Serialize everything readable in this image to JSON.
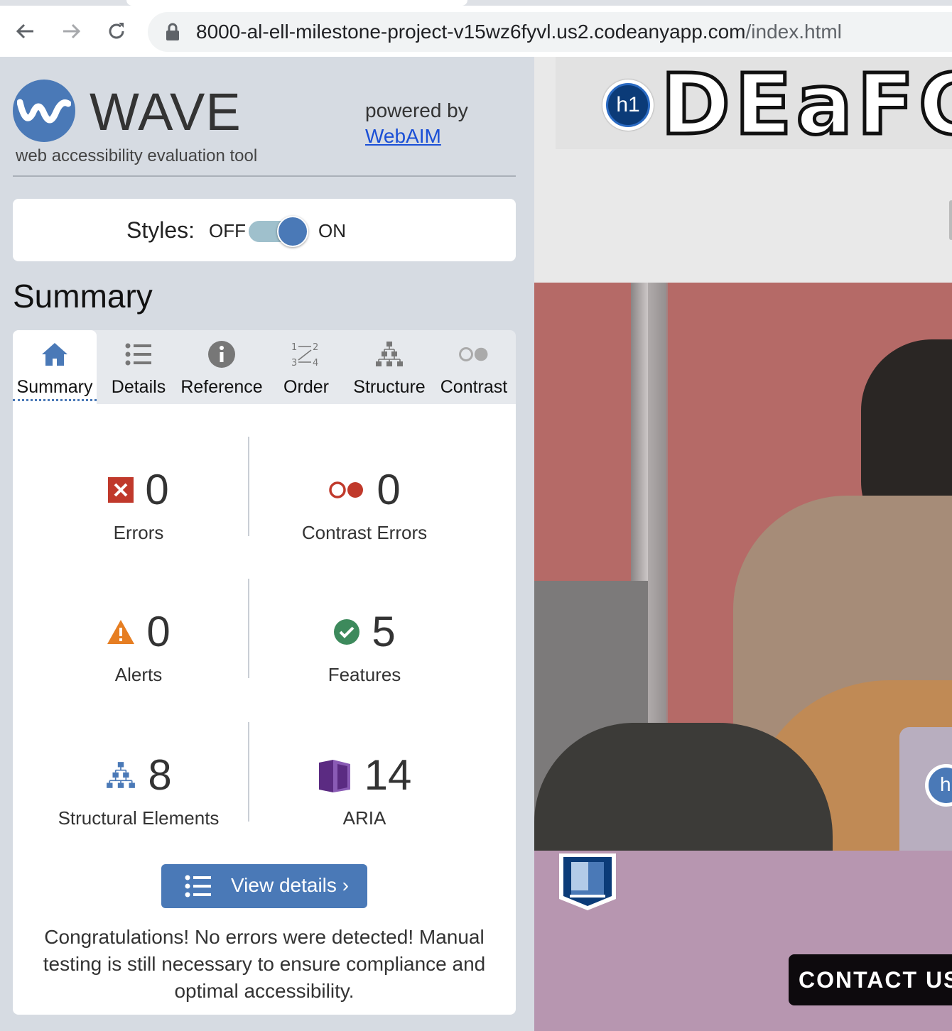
{
  "browser": {
    "url_host": "8000-al-ell-milestone-project-v15wz6fyvl.us2.codeanyapp.com",
    "url_path": "/index.html"
  },
  "wave": {
    "title": "WAVE",
    "subtitle": "web accessibility evaluation tool",
    "powered_by": "powered by",
    "webaim": "WebAIM",
    "styles_label": "Styles:",
    "styles_off": "OFF",
    "styles_on": "ON",
    "styles_state": "on",
    "summary_heading": "Summary",
    "tabs": [
      {
        "label": "Summary",
        "icon": "home-icon",
        "active": true
      },
      {
        "label": "Details",
        "icon": "list-icon",
        "active": false
      },
      {
        "label": "Reference",
        "icon": "info-icon",
        "active": false
      },
      {
        "label": "Order",
        "icon": "order-icon",
        "active": false
      },
      {
        "label": "Structure",
        "icon": "structure-icon",
        "active": false
      },
      {
        "label": "Contrast",
        "icon": "contrast-icon",
        "active": false
      }
    ],
    "stats": {
      "errors": {
        "value": "0",
        "label": "Errors"
      },
      "contrast_errors": {
        "value": "0",
        "label": "Contrast Errors"
      },
      "alerts": {
        "value": "0",
        "label": "Alerts"
      },
      "features": {
        "value": "5",
        "label": "Features"
      },
      "structural": {
        "value": "8",
        "label": "Structural Elements"
      },
      "aria": {
        "value": "14",
        "label": "ARIA"
      }
    },
    "view_details": "View details ›",
    "congrats": "Congratulations! No errors were detected! Manual testing is still necessary to ensure compliance and optimal accessibility."
  },
  "page": {
    "site_title": "DEaFC",
    "h1_badge": "h1",
    "h_badge": "h",
    "contact_button": "CONTACT US"
  },
  "colors": {
    "wave_blue": "#4a79b7",
    "error_red": "#c0392b",
    "alert_orange": "#e67e22",
    "feature_green": "#3d8a5c",
    "aria_purple": "#5b2b82",
    "footer_mauve": "#b796b0"
  }
}
